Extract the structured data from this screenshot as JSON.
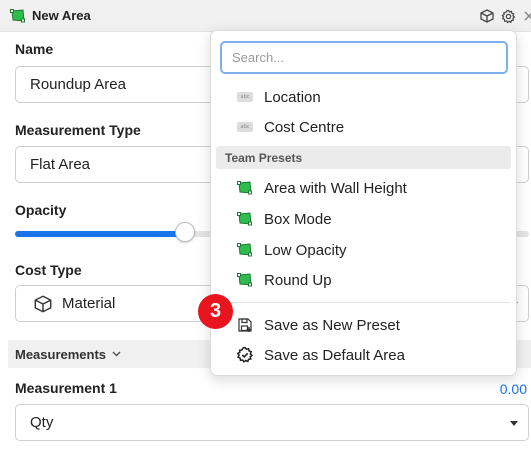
{
  "header": {
    "title": "New Area",
    "icons": [
      "area-polygon-icon",
      "cube-icon",
      "gear-icon",
      "close-icon"
    ]
  },
  "form": {
    "name_label": "Name",
    "name_value": "Roundup Area",
    "measurement_type_label": "Measurement Type",
    "measurement_type_value": "Flat Area",
    "opacity_label": "Opacity",
    "opacity_level": 0.33,
    "cost_type_label": "Cost Type",
    "cost_type_value": "Material",
    "measurements_section": "Measurements",
    "measurement1_label": "Measurement 1",
    "measurement1_value": "0.00",
    "measurement1_unit": "Qty"
  },
  "dropdown": {
    "search_placeholder": "Search...",
    "fields": [
      {
        "label": "Location",
        "icon": "abc-field-icon"
      },
      {
        "label": "Cost Centre",
        "icon": "abc-field-icon"
      }
    ],
    "team_presets_header": "Team Presets",
    "presets": [
      {
        "label": "Area with Wall Height",
        "icon": "area-polygon-icon"
      },
      {
        "label": "Box Mode",
        "icon": "area-polygon-icon"
      },
      {
        "label": "Low Opacity",
        "icon": "area-polygon-icon"
      },
      {
        "label": "Round Up",
        "icon": "area-polygon-icon"
      }
    ],
    "actions": [
      {
        "label": "Save as New Preset",
        "icon": "save-preset-icon"
      },
      {
        "label": "Save as Default Area",
        "icon": "gear-check-icon"
      }
    ]
  },
  "annotation": {
    "step": "3"
  },
  "colors": {
    "accent": "#1a73e8",
    "preset_green": "#2ebd4e",
    "badge_red": "#e8151f"
  }
}
